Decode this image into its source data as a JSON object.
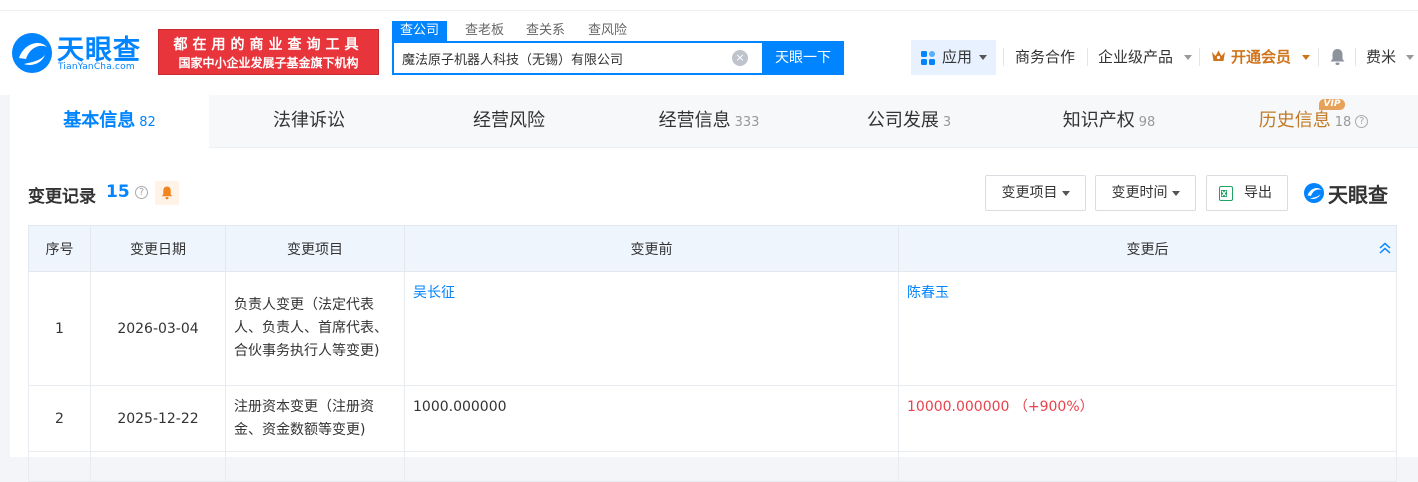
{
  "header": {
    "logo": {
      "name": "天眼查",
      "domain": "TianYanCha.com"
    },
    "banner": {
      "line1": "都在用的商业查询工具",
      "line2": "国家中小企业发展子基金旗下机构"
    },
    "search_tabs": [
      "查公司",
      "查老板",
      "查关系",
      "查风险"
    ],
    "search": {
      "value": "魔法原子机器人科技（无锡）有限公司",
      "button": "天眼一下"
    },
    "nav": {
      "app": "应用",
      "business": "商务合作",
      "enterprise": "企业级产品",
      "vip": "开通会员",
      "user": "费米"
    }
  },
  "tabs": [
    {
      "label": "基本信息",
      "count": "82"
    },
    {
      "label": "法律诉讼",
      "count": ""
    },
    {
      "label": "经营风险",
      "count": ""
    },
    {
      "label": "经营信息",
      "count": "333"
    },
    {
      "label": "公司发展",
      "count": "3"
    },
    {
      "label": "知识产权",
      "count": "98"
    },
    {
      "label": "历史信息",
      "count": "18"
    }
  ],
  "vip_badge": "VIP",
  "section": {
    "title": "变更记录",
    "count": "15",
    "filter_item": "变更项目",
    "filter_time": "变更时间",
    "export": "导出",
    "brand": "天眼查"
  },
  "table": {
    "headers": [
      "序号",
      "变更日期",
      "变更项目",
      "变更前",
      "变更后"
    ],
    "rows": [
      {
        "index": "1",
        "date": "2026-03-04",
        "item": "负责人变更（法定代表人、负责人、首席代表、合伙事务执行人等变更)",
        "before": "吴长征",
        "after": "陈春玉"
      },
      {
        "index": "2",
        "date": "2025-12-22",
        "item": "注册资本变更（注册资金、资金数额等变更)",
        "before": "1000.000000",
        "after": "10000.000000 （+900%）"
      }
    ]
  },
  "colors": {
    "brand_blue": "#0084ff",
    "banner_red": "#e8353b",
    "vip_gold": "#d0741c",
    "increase_red": "#e8424c"
  }
}
